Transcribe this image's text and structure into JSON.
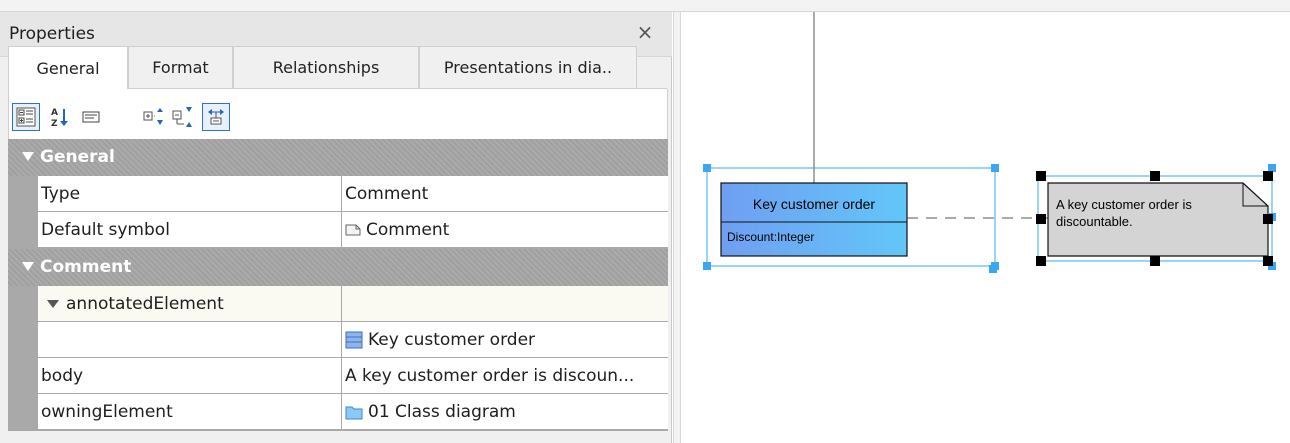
{
  "panel": {
    "title": "Properties",
    "close_glyph": "×"
  },
  "tabs": [
    {
      "label": "General",
      "active": true
    },
    {
      "label": "Format",
      "active": false
    },
    {
      "label": "Relationships",
      "active": false
    },
    {
      "label": "Presentations in dia..",
      "active": false
    }
  ],
  "toolbar": {
    "buttons": [
      {
        "icon": "categorized-view-icon",
        "selected": true
      },
      {
        "icon": "sort-alphabetical-icon",
        "selected": false
      },
      {
        "icon": "description-icon",
        "selected": false
      },
      {
        "icon": "expand-all-icon",
        "selected": false
      },
      {
        "icon": "collapse-all-icon",
        "selected": false
      },
      {
        "icon": "show-hidden-icon",
        "selected": true
      }
    ]
  },
  "groups": {
    "general": {
      "label": "General",
      "rows": [
        {
          "key": "Type",
          "value": "Comment"
        },
        {
          "key": "Default symbol",
          "value": "Comment"
        }
      ]
    },
    "comment": {
      "label": "Comment",
      "annotated_label": "annotatedElement",
      "annotated_value": "Key customer order",
      "body_key": "body",
      "body_value": "A key customer order is discoun...",
      "owning_key": "owningElement",
      "owning_value": "01 Class diagram"
    }
  },
  "diagram": {
    "class_name": "Key customer order",
    "class_attribute": "Discount:Integer",
    "comment_line1": "A key customer order is",
    "comment_line2": "discountable."
  },
  "colors": {
    "selection": "#3aa7f0",
    "class_fill_left": "#6f9ff2",
    "class_fill_right": "#62c6f8",
    "comment_fill": "#d4d4d4",
    "group_header": "#a6a6a6"
  }
}
